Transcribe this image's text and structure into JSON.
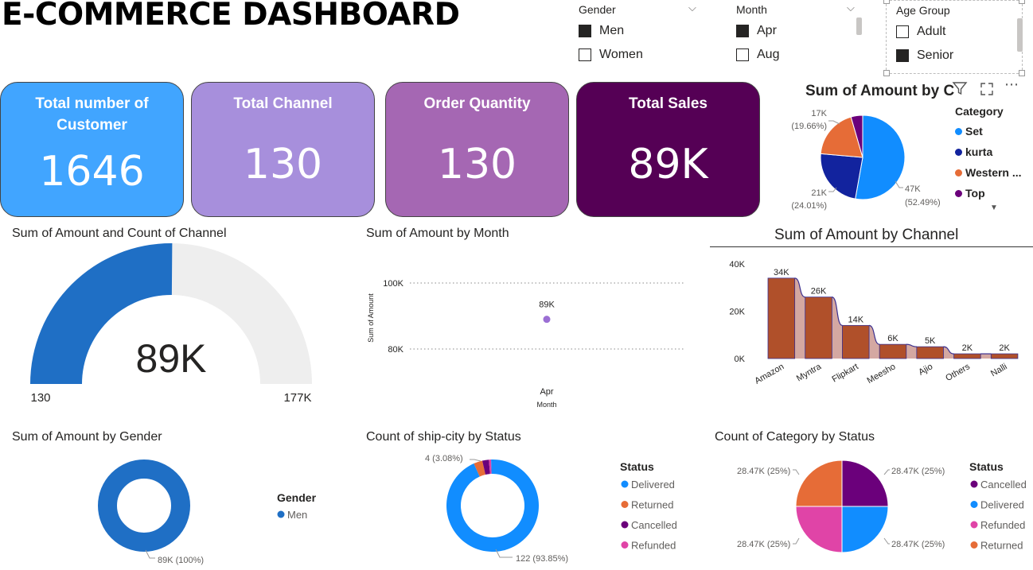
{
  "title": "E-COMMERCE DASHBOARD",
  "slicers": {
    "gender": {
      "label": "Gender",
      "options": [
        {
          "label": "Men",
          "checked": true
        },
        {
          "label": "Women",
          "checked": false
        }
      ]
    },
    "month": {
      "label": "Month",
      "options": [
        {
          "label": "Apr",
          "checked": true
        },
        {
          "label": "Aug",
          "checked": false
        }
      ]
    },
    "age_group": {
      "label": "Age Group",
      "options": [
        {
          "label": "Adult",
          "checked": false
        },
        {
          "label": "Senior",
          "checked": true
        }
      ]
    }
  },
  "cards": [
    {
      "label": "Total number of Customer",
      "value": "1646",
      "color": "#41A5FF"
    },
    {
      "label": "Total Channel",
      "value": "130",
      "color": "#A78FDC"
    },
    {
      "label": "Order Quantity",
      "value": "130",
      "color": "#A567B3"
    },
    {
      "label": "Total Sales",
      "value": "89K",
      "color": "#550055"
    }
  ],
  "visuals": {
    "category_pie": {
      "title": "Sum of Amount by C",
      "legend_title": "Category",
      "legend": [
        "Set",
        "kurta",
        "Western ...",
        "Top"
      ]
    },
    "gauge": {
      "title": "Sum of Amount and Count of Channel",
      "value": "89K",
      "min": "130",
      "max": "177K"
    },
    "month_scatter": {
      "title": "Sum of Amount by Month",
      "ylabel": "Sum of Amount",
      "xlabel": "Month",
      "y_ticks": [
        "100K",
        "80K"
      ],
      "x_tick": "Apr",
      "point_label": "89K"
    },
    "channel_bar": {
      "title": "Sum of Amount by Channel",
      "y_ticks": [
        "40K",
        "20K",
        "0K"
      ]
    },
    "gender_donut": {
      "title": "Sum of Amount by Gender",
      "legend_title": "Gender",
      "legend": [
        "Men"
      ],
      "label": "89K (100%)"
    },
    "city_status": {
      "title": "Count of ship-city by Status",
      "legend_title": "Status",
      "legend": [
        "Delivered",
        "Returned",
        "Cancelled",
        "Refunded"
      ],
      "label_small": "4 (3.08%)",
      "label_big": "122 (93.85%)"
    },
    "category_status": {
      "title": "Count of Category by Status",
      "legend_title": "Status",
      "legend": [
        "Cancelled",
        "Delivered",
        "Refunded",
        "Returned"
      ],
      "labels": [
        "28.47K (25%)",
        "28.47K (25%)",
        "28.47K (25%)",
        "28.47K (25%)"
      ]
    }
  },
  "chart_data": [
    {
      "type": "pie",
      "title": "Sum of Amount by C",
      "categories": [
        "Set",
        "kurta",
        "Western ...",
        "Top"
      ],
      "values": [
        47,
        21,
        17,
        4
      ],
      "data_labels": [
        "47K (52.49%)",
        "21K (24.01%)",
        "17K (19.66%)",
        ""
      ],
      "colors": [
        "#118DFF",
        "#12239E",
        "#E66C37",
        "#6B007B"
      ]
    },
    {
      "type": "gauge",
      "title": "Sum of Amount and Count of Channel",
      "value": 89,
      "min": 0.13,
      "max": 177,
      "colors": [
        "#1F6FC5",
        "#EEEEEE"
      ]
    },
    {
      "type": "scatter",
      "title": "Sum of Amount by Month",
      "categories": [
        "Apr"
      ],
      "values": [
        89
      ],
      "ylim": [
        76,
        105
      ],
      "ylabel": "Sum of Amount",
      "xlabel": "Month",
      "colors": [
        "#9B6FD4"
      ]
    },
    {
      "type": "bar",
      "title": "Sum of Amount by Channel",
      "categories": [
        "Amazon",
        "Myntra",
        "Flipkart",
        "Meesho",
        "Ajio",
        "Others",
        "Nalli"
      ],
      "values": [
        34,
        26,
        14,
        6,
        5,
        2,
        2
      ],
      "data_labels": [
        "34K",
        "26K",
        "14K",
        "6K",
        "5K",
        "2K",
        "2K"
      ],
      "ylim": [
        0,
        40
      ],
      "grid": false,
      "colors": [
        "#B0502A",
        "#D4A8A2"
      ]
    },
    {
      "type": "pie",
      "title": "Sum of Amount by Gender",
      "categories": [
        "Men"
      ],
      "values": [
        89
      ],
      "data_labels": [
        "89K (100%)"
      ],
      "colors": [
        "#1F6FC5"
      ]
    },
    {
      "type": "pie",
      "title": "Count of ship-city by Status",
      "categories": [
        "Delivered",
        "Returned",
        "Cancelled",
        "Refunded"
      ],
      "values": [
        122,
        4,
        3,
        1
      ],
      "data_labels": [
        "122 (93.85%)",
        "4 (3.08%)",
        "",
        ""
      ],
      "colors": [
        "#118DFF",
        "#E66C37",
        "#6B007B",
        "#E044A7"
      ]
    },
    {
      "type": "pie",
      "title": "Count of Category by Status",
      "categories": [
        "Cancelled",
        "Delivered",
        "Refunded",
        "Returned"
      ],
      "values": [
        28.47,
        28.47,
        28.47,
        28.47
      ],
      "data_labels": [
        "28.47K (25%)",
        "28.47K (25%)",
        "28.47K (25%)",
        "28.47K (25%)"
      ],
      "colors": [
        "#6B007B",
        "#118DFF",
        "#E044A7",
        "#E66C37"
      ]
    }
  ]
}
